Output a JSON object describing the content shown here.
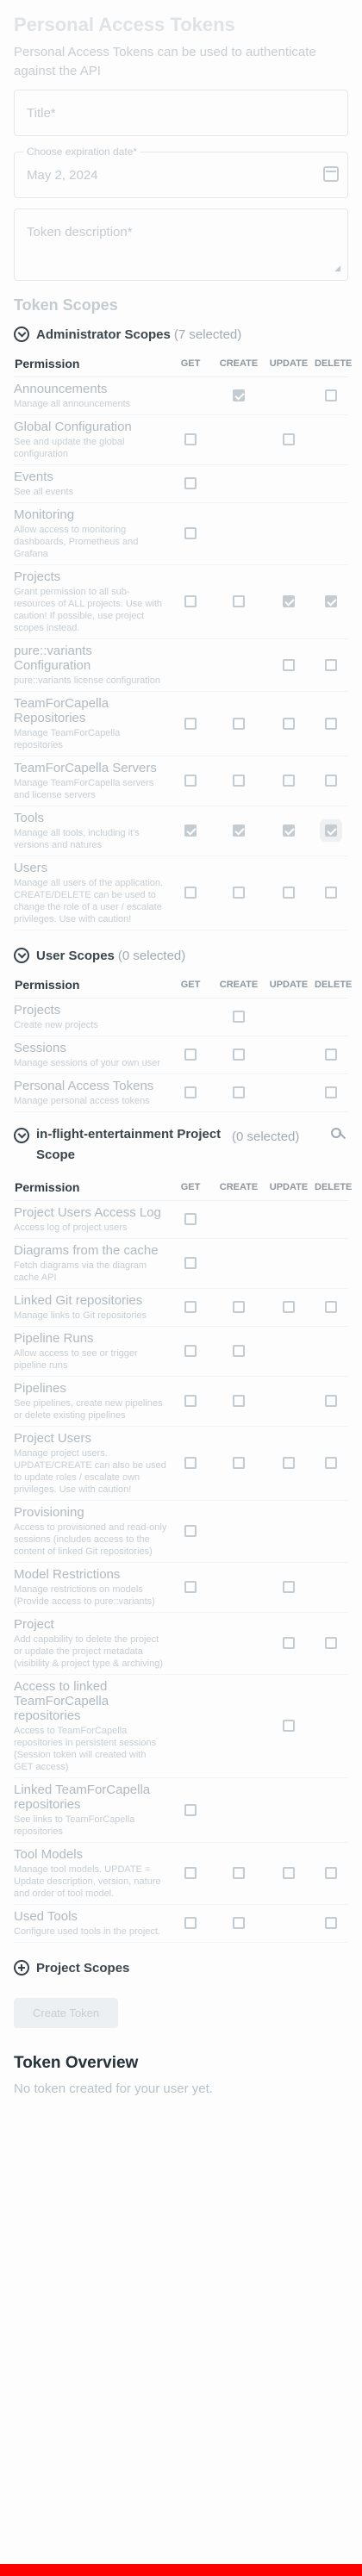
{
  "page_title": "Personal Access Tokens",
  "page_desc": "Personal Access Tokens can be used to authenticate against the API",
  "form": {
    "title_placeholder": "Title*",
    "date_legend": "Choose expiration date*",
    "date_value": "May 2, 2024",
    "desc_placeholder": "Token description*"
  },
  "scopes_heading": "Token Scopes",
  "columns": {
    "permission": "Permission",
    "get": "GET",
    "create": "CREATE",
    "update": "UPDATE",
    "delete": "DELETE"
  },
  "admin": {
    "title": "Administrator Scopes",
    "count": "(7 selected)",
    "rows": [
      {
        "name": "Announcements",
        "desc": "Manage all announcements",
        "cells": [
          "",
          "on",
          "",
          "off"
        ]
      },
      {
        "name": "Global Configuration",
        "desc": "See and update the global configuration",
        "cells": [
          "off",
          "",
          "off",
          ""
        ]
      },
      {
        "name": "Events",
        "desc": "See all events",
        "cells": [
          "off",
          "",
          "",
          ""
        ]
      },
      {
        "name": "Monitoring",
        "desc": "Allow access to monitoring dashboards, Prometheus and Grafana",
        "cells": [
          "off",
          "",
          "",
          ""
        ]
      },
      {
        "name": "Projects",
        "desc": "Grant permission to all sub-resources of ALL projects. Use with caution! If possible, use project scopes instead.",
        "cells": [
          "off",
          "off",
          "on",
          "on"
        ]
      },
      {
        "name": "pure::variants Configuration",
        "desc": "pure::variants license configuration",
        "cells": [
          "",
          "",
          "off",
          "off"
        ]
      },
      {
        "name": "TeamForCapella Repositories",
        "desc": "Manage TeamForCapella repositories",
        "cells": [
          "off",
          "off",
          "off",
          "off"
        ]
      },
      {
        "name": "TeamForCapella Servers",
        "desc": "Manage TeamForCapella servers and license servers",
        "cells": [
          "off",
          "off",
          "off",
          "off"
        ]
      },
      {
        "name": "Tools",
        "desc": "Manage all tools, including it's versions and natures",
        "cells": [
          "on",
          "on",
          "on",
          "on-hl"
        ]
      },
      {
        "name": "Users",
        "desc": "Manage all users of the application. CREATE/DELETE can be used to change the role of a user / escalate privileges. Use with caution!",
        "cells": [
          "off",
          "off",
          "off",
          "off"
        ]
      }
    ]
  },
  "user": {
    "title": "User Scopes",
    "count": "(0 selected)",
    "rows": [
      {
        "name": "Projects",
        "desc": "Create new projects",
        "cells": [
          "",
          "off",
          "",
          ""
        ]
      },
      {
        "name": "Sessions",
        "desc": "Manage sessions of your own user",
        "cells": [
          "off",
          "off",
          "",
          "off"
        ]
      },
      {
        "name": "Personal Access Tokens",
        "desc": "Manage personal access tokens",
        "cells": [
          "off",
          "off",
          "",
          "off"
        ]
      }
    ]
  },
  "project": {
    "title": "in-flight-entertainment Project Scope",
    "count": "(0 selected)",
    "rows": [
      {
        "name": "Project Users Access Log",
        "desc": "Access log of project users",
        "cells": [
          "off",
          "",
          "",
          ""
        ]
      },
      {
        "name": "Diagrams from the cache",
        "desc": "Fetch diagrams via the diagram cache API",
        "cells": [
          "off",
          "",
          "",
          ""
        ]
      },
      {
        "name": "Linked Git repositories",
        "desc": "Manage links to Git repositories",
        "cells": [
          "off",
          "off",
          "off",
          "off"
        ]
      },
      {
        "name": "Pipeline Runs",
        "desc": "Allow access to see or trigger pipeline runs",
        "cells": [
          "off",
          "off",
          "",
          ""
        ]
      },
      {
        "name": "Pipelines",
        "desc": "See pipelines, create new pipelines or delete existing pipelines",
        "cells": [
          "off",
          "off",
          "",
          "off"
        ]
      },
      {
        "name": "Project Users",
        "desc": "Manage project users. UPDATE/CREATE can also be used to update roles / escalate own privileges. Use with caution!",
        "cells": [
          "off",
          "off",
          "off",
          "off"
        ]
      },
      {
        "name": "Provisioning",
        "desc": "Access to provisioned and read-only sessions (includes access to the content of linked Git repositories)",
        "cells": [
          "off",
          "",
          "",
          ""
        ]
      },
      {
        "name": "Model Restrictions",
        "desc": "Manage restrictions on models (Provide access to pure::variants)",
        "cells": [
          "off",
          "",
          "off",
          ""
        ]
      },
      {
        "name": "Project",
        "desc": "Add capability to delete the project or update the project metadata (visibility & project type & archiving)",
        "cells": [
          "",
          "",
          "off",
          "off"
        ]
      },
      {
        "name": "Access to linked TeamForCapella repositories",
        "desc": "Access to TeamForCapella repositories in persistent sessions (Session token will created with GET access)",
        "cells": [
          "",
          "",
          "off",
          ""
        ]
      },
      {
        "name": "Linked TeamForCapella repositories",
        "desc": "See links to TeamForCapella repositories",
        "cells": [
          "off",
          "",
          "",
          ""
        ]
      },
      {
        "name": "Tool Models",
        "desc": "Manage tool models. UPDATE = Update description, version, nature and order of tool model.",
        "cells": [
          "off",
          "off",
          "off",
          "off"
        ]
      },
      {
        "name": "Used Tools",
        "desc": "Configure used tools in the project.",
        "cells": [
          "off",
          "off",
          "",
          "off"
        ]
      }
    ]
  },
  "project_scopes_label": "Project Scopes",
  "create_button": "Create Token",
  "overview_heading": "Token Overview",
  "overview_empty": "No token created for your user yet."
}
